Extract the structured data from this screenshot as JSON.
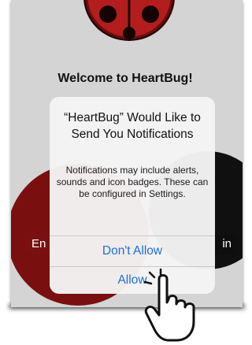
{
  "app": {
    "welcome_text": "Welcome to HeartBug!",
    "bg_button_left": "En",
    "bg_button_right": "in"
  },
  "alert": {
    "title": "“HeartBug” Would Like to Send You Notifications",
    "message": "Notifications may include alerts, sounds and icon badges. These can be configured in Settings.",
    "dont_allow_label": "Don't Allow",
    "allow_label": "Allow"
  },
  "colors": {
    "accent": "#1f6fd6",
    "ladybug_red": "#b21e1e",
    "background": "#d4d4d4"
  },
  "icons": [
    "ladybug-logo-icon",
    "pointing-hand-icon"
  ]
}
